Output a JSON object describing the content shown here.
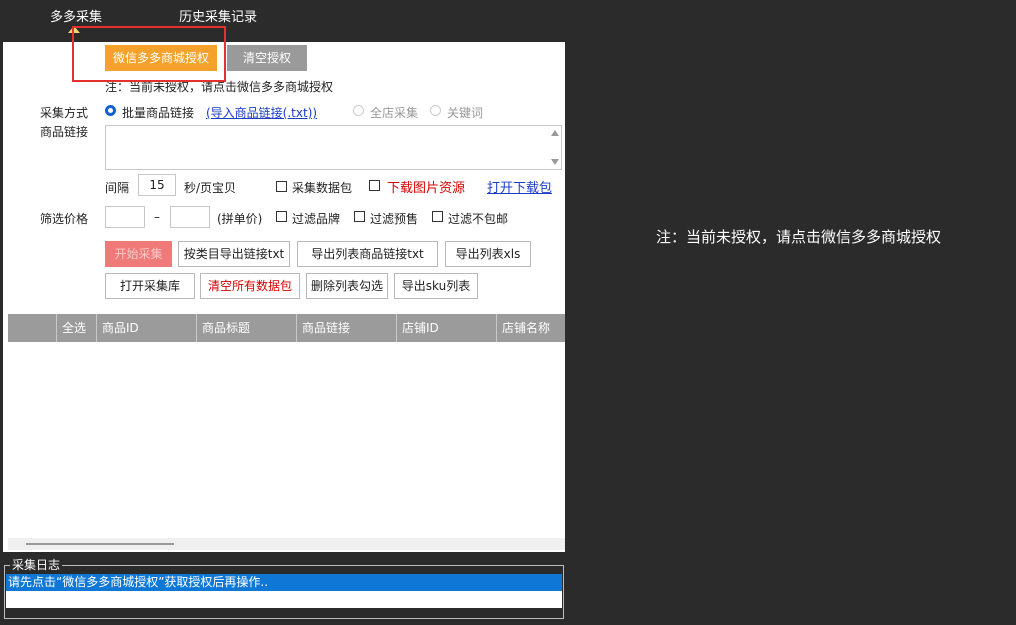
{
  "tabs": [
    {
      "label": "多多采集"
    },
    {
      "label": "历史采集记录"
    }
  ],
  "auth": {
    "authorize_label": "微信多多商城授权",
    "clear_label": "清空授权",
    "note": "注：当前未授权，请点击微信多多商城授权"
  },
  "collect": {
    "mode_label": "采集方式",
    "link_label": "商品链接",
    "options": [
      {
        "label": "批量商品链接",
        "selected": true
      },
      {
        "label": "全店采集",
        "selected": false
      },
      {
        "label": "关键词",
        "selected": false
      }
    ],
    "import_link": "(导入商品链接(.txt))",
    "interval_label": "间隔",
    "interval_value": "15",
    "interval_unit": "秒/页宝贝",
    "data_pack_label": "采集数据包",
    "download_images_label": "下载图片资源",
    "open_download_label": "打开下载包"
  },
  "filter": {
    "price_label": "筛选价格",
    "dash": "–",
    "unit_price": "(拼单价)",
    "brand": "过滤品牌",
    "presale": "过滤预售",
    "no_shipping": "过滤不包邮"
  },
  "actions": {
    "start": "开始采集",
    "export_by_category": "按类目导出链接txt",
    "export_list_links": "导出列表商品链接txt",
    "export_xls": "导出列表xls",
    "open_library": "打开采集库",
    "clear_all": "清空所有数据包",
    "delete_checked": "删除列表勾选",
    "export_sku": "导出sku列表"
  },
  "table": {
    "columns": [
      "",
      "全选",
      "商品ID",
      "商品标题",
      "商品链接",
      "店铺ID",
      "店铺名称"
    ]
  },
  "log": {
    "title": "采集日志",
    "lines": [
      "请先点击“微信多多商城授权”获取授权后再操作.."
    ]
  },
  "right_note": "注：当前未授权，请点击微信多多商城授权",
  "colors": {
    "background": "#2b2b2b",
    "orange": "#f4a22c",
    "gray": "#9a9a9a",
    "start_red": "#f07a7a",
    "log_select": "#0f78d7",
    "highlight": "#e53030"
  }
}
